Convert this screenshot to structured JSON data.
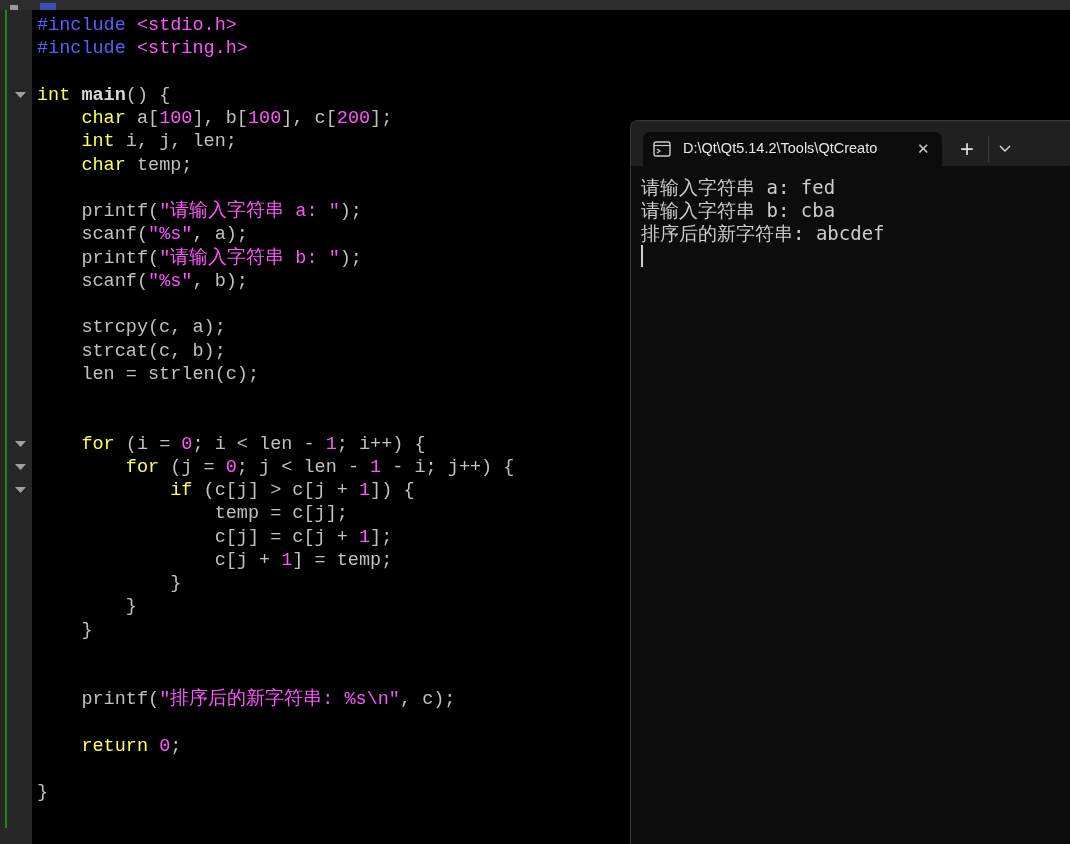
{
  "editor": {
    "lines": [
      {
        "foldable": false,
        "tokens": [
          {
            "kind": "preproc",
            "text": "#include"
          },
          {
            "kind": "header",
            "text": " <stdio.h>"
          }
        ]
      },
      {
        "foldable": false,
        "tokens": [
          {
            "kind": "preproc",
            "text": "#include"
          },
          {
            "kind": "header",
            "text": " <string.h>"
          }
        ]
      },
      {
        "foldable": false
      },
      {
        "foldable": true,
        "tokens": [
          {
            "kind": "keyword",
            "text": "int"
          },
          {
            "kind": "function",
            "text": " main"
          },
          {
            "kind": "plain",
            "text": "() {"
          }
        ]
      },
      {
        "foldable": false,
        "tokens": [
          {
            "kind": "keyword",
            "text": "    char"
          },
          {
            "kind": "plain",
            "text": " a["
          },
          {
            "kind": "number",
            "text": "100"
          },
          {
            "kind": "plain",
            "text": "], b["
          },
          {
            "kind": "number",
            "text": "100"
          },
          {
            "kind": "plain",
            "text": "], c["
          },
          {
            "kind": "number",
            "text": "200"
          },
          {
            "kind": "plain",
            "text": "];"
          }
        ]
      },
      {
        "foldable": false,
        "tokens": [
          {
            "kind": "keyword",
            "text": "    int"
          },
          {
            "kind": "plain",
            "text": " i, j, len;"
          }
        ]
      },
      {
        "foldable": false,
        "tokens": [
          {
            "kind": "keyword",
            "text": "    char"
          },
          {
            "kind": "plain",
            "text": " temp;"
          }
        ]
      },
      {
        "foldable": false
      },
      {
        "foldable": false,
        "tokens": [
          {
            "kind": "plain",
            "text": "    printf("
          },
          {
            "kind": "string",
            "text": "\"请输入字符串 a: \""
          },
          {
            "kind": "plain",
            "text": ");"
          }
        ]
      },
      {
        "foldable": false,
        "tokens": [
          {
            "kind": "plain",
            "text": "    scanf("
          },
          {
            "kind": "string",
            "text": "\"%s\""
          },
          {
            "kind": "plain",
            "text": ", a);"
          }
        ]
      },
      {
        "foldable": false,
        "tokens": [
          {
            "kind": "plain",
            "text": "    printf("
          },
          {
            "kind": "string",
            "text": "\"请输入字符串 b: \""
          },
          {
            "kind": "plain",
            "text": ");"
          }
        ]
      },
      {
        "foldable": false,
        "tokens": [
          {
            "kind": "plain",
            "text": "    scanf("
          },
          {
            "kind": "string",
            "text": "\"%s\""
          },
          {
            "kind": "plain",
            "text": ", b);"
          }
        ]
      },
      {
        "foldable": false
      },
      {
        "foldable": false,
        "tokens": [
          {
            "kind": "plain",
            "text": "    strcpy(c, a);"
          }
        ]
      },
      {
        "foldable": false,
        "tokens": [
          {
            "kind": "plain",
            "text": "    strcat(c, b);"
          }
        ]
      },
      {
        "foldable": false,
        "tokens": [
          {
            "kind": "plain",
            "text": "    len = strlen(c);"
          }
        ]
      },
      {
        "foldable": false
      },
      {
        "foldable": false
      },
      {
        "foldable": true,
        "tokens": [
          {
            "kind": "keyword",
            "text": "    for"
          },
          {
            "kind": "plain",
            "text": " (i = "
          },
          {
            "kind": "number",
            "text": "0"
          },
          {
            "kind": "plain",
            "text": "; i < len - "
          },
          {
            "kind": "number",
            "text": "1"
          },
          {
            "kind": "plain",
            "text": "; i++) {"
          }
        ]
      },
      {
        "foldable": true,
        "tokens": [
          {
            "kind": "keyword",
            "text": "        for"
          },
          {
            "kind": "plain",
            "text": " (j = "
          },
          {
            "kind": "number",
            "text": "0"
          },
          {
            "kind": "plain",
            "text": "; j < len - "
          },
          {
            "kind": "number",
            "text": "1"
          },
          {
            "kind": "plain",
            "text": " - i; j++) {"
          }
        ]
      },
      {
        "foldable": true,
        "tokens": [
          {
            "kind": "keyword",
            "text": "            if"
          },
          {
            "kind": "plain",
            "text": " (c[j] > c[j + "
          },
          {
            "kind": "number",
            "text": "1"
          },
          {
            "kind": "plain",
            "text": "]) {"
          }
        ]
      },
      {
        "foldable": false,
        "tokens": [
          {
            "kind": "plain",
            "text": "                temp = c[j];"
          }
        ]
      },
      {
        "foldable": false,
        "tokens": [
          {
            "kind": "plain",
            "text": "                c[j] = c[j + "
          },
          {
            "kind": "number",
            "text": "1"
          },
          {
            "kind": "plain",
            "text": "];"
          }
        ]
      },
      {
        "foldable": false,
        "tokens": [
          {
            "kind": "plain",
            "text": "                c[j + "
          },
          {
            "kind": "number",
            "text": "1"
          },
          {
            "kind": "plain",
            "text": "] = temp;"
          }
        ]
      },
      {
        "foldable": false,
        "tokens": [
          {
            "kind": "plain",
            "text": "            }"
          }
        ]
      },
      {
        "foldable": false,
        "tokens": [
          {
            "kind": "plain",
            "text": "        }"
          }
        ]
      },
      {
        "foldable": false,
        "tokens": [
          {
            "kind": "plain",
            "text": "    }"
          }
        ]
      },
      {
        "foldable": false
      },
      {
        "foldable": false
      },
      {
        "foldable": false,
        "tokens": [
          {
            "kind": "plain",
            "text": "    printf("
          },
          {
            "kind": "string",
            "text": "\"排序后的新字符串: %s\\n\""
          },
          {
            "kind": "plain",
            "text": ", c);"
          }
        ]
      },
      {
        "foldable": false
      },
      {
        "foldable": false,
        "tokens": [
          {
            "kind": "keyword",
            "text": "    return"
          },
          {
            "kind": "number",
            "text": " 0"
          },
          {
            "kind": "plain",
            "text": ";"
          }
        ]
      },
      {
        "foldable": false
      },
      {
        "foldable": false,
        "tokens": [
          {
            "kind": "plain",
            "text": "}"
          }
        ]
      }
    ]
  },
  "terminal": {
    "tab_title": "D:\\Qt\\Qt5.14.2\\Tools\\QtCreato",
    "tab_close": "✕",
    "new_tab": "+",
    "output_lines": [
      "请输入字符串 a: fed",
      "请输入字符串 b: cba",
      "排序后的新字符串: abcdef"
    ]
  }
}
